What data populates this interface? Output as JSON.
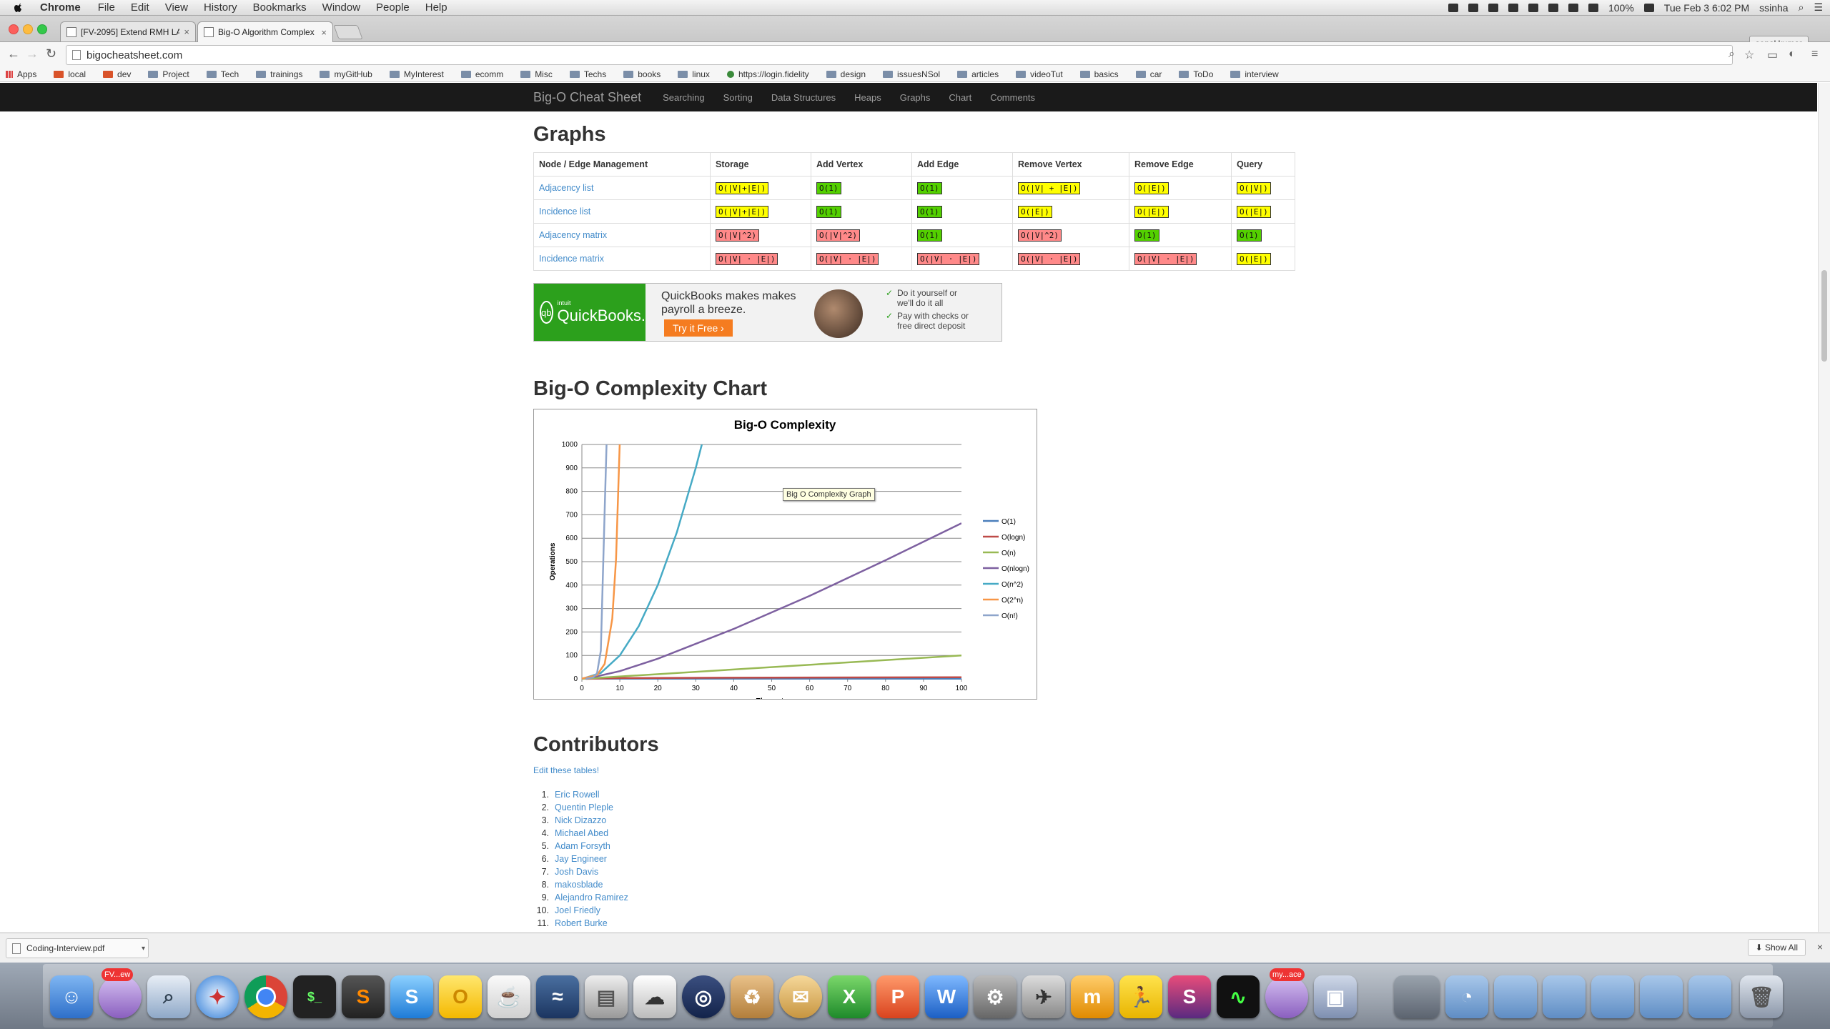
{
  "menubar": {
    "app": "Chrome",
    "items": [
      "File",
      "Edit",
      "View",
      "History",
      "Bookmarks",
      "Window",
      "People",
      "Help"
    ],
    "battery": "100%",
    "clock": "Tue Feb 3  6:02 PM",
    "user": "ssinha"
  },
  "tabs": [
    {
      "label": "[FV-2095] Extend RMH LA"
    },
    {
      "label": "Big-O Algorithm Complex"
    }
  ],
  "profile_button": "sonal kumar",
  "address": "bigocheatsheet.com",
  "bookmarks": [
    "Apps",
    "local",
    "dev",
    "Project",
    "Tech",
    "trainings",
    "myGitHub",
    "MyInterest",
    "ecomm",
    "Misc",
    "Techs",
    "books",
    "linux",
    "https://login.fidelity",
    "design",
    "issuesNSol",
    "articles",
    "videoTut",
    "basics",
    "car",
    "ToDo",
    "interview"
  ],
  "sitenav": {
    "brand": "Big-O Cheat Sheet",
    "links": [
      "Searching",
      "Sorting",
      "Data Structures",
      "Heaps",
      "Graphs",
      "Chart",
      "Comments"
    ]
  },
  "graphs": {
    "title": "Graphs",
    "headers": [
      "Node / Edge Management",
      "Storage",
      "Add Vertex",
      "Add Edge",
      "Remove Vertex",
      "Remove Edge",
      "Query"
    ],
    "rows": [
      {
        "name": "Adjacency list",
        "cells": [
          {
            "text": "O(|V|+|E|)",
            "color": "yellow"
          },
          {
            "text": "O(1)",
            "color": "green"
          },
          {
            "text": "O(1)",
            "color": "green"
          },
          {
            "text": "O(|V| + |E|)",
            "color": "yellow"
          },
          {
            "text": "O(|E|)",
            "color": "yellow"
          },
          {
            "text": "O(|V|)",
            "color": "yellow"
          }
        ]
      },
      {
        "name": "Incidence list",
        "cells": [
          {
            "text": "O(|V|+|E|)",
            "color": "yellow"
          },
          {
            "text": "O(1)",
            "color": "green"
          },
          {
            "text": "O(1)",
            "color": "green"
          },
          {
            "text": "O(|E|)",
            "color": "yellow"
          },
          {
            "text": "O(|E|)",
            "color": "yellow"
          },
          {
            "text": "O(|E|)",
            "color": "yellow"
          }
        ]
      },
      {
        "name": "Adjacency matrix",
        "cells": [
          {
            "text": "O(|V|^2)",
            "color": "red"
          },
          {
            "text": "O(|V|^2)",
            "color": "red"
          },
          {
            "text": "O(1)",
            "color": "green"
          },
          {
            "text": "O(|V|^2)",
            "color": "red"
          },
          {
            "text": "O(1)",
            "color": "green"
          },
          {
            "text": "O(1)",
            "color": "green"
          }
        ]
      },
      {
        "name": "Incidence matrix",
        "cells": [
          {
            "text": "O(|V| ⋅ |E|)",
            "color": "red"
          },
          {
            "text": "O(|V| ⋅ |E|)",
            "color": "red"
          },
          {
            "text": "O(|V| ⋅ |E|)",
            "color": "red"
          },
          {
            "text": "O(|V| ⋅ |E|)",
            "color": "red"
          },
          {
            "text": "O(|V| ⋅ |E|)",
            "color": "red"
          },
          {
            "text": "O(|E|)",
            "color": "yellow"
          }
        ]
      }
    ]
  },
  "ad": {
    "brand_small": "intuit",
    "brand": "QuickBooks.",
    "headline": "QuickBooks makes makes payroll a breeze.",
    "cta": "Try it Free",
    "bullets": [
      "Do it yourself or we'll do it all",
      "Pay with checks or free direct deposit"
    ]
  },
  "chart_section_title": "Big-O Complexity Chart",
  "tooltip": "Big O Complexity Graph",
  "chart_data": {
    "type": "line",
    "title": "Big-O Complexity",
    "xlabel": "Elements",
    "ylabel": "Operations",
    "xlim": [
      0,
      100
    ],
    "ylim": [
      0,
      1000
    ],
    "xticks": [
      0,
      10,
      20,
      30,
      40,
      50,
      60,
      70,
      80,
      90,
      100
    ],
    "yticks": [
      0,
      100,
      200,
      300,
      400,
      500,
      600,
      700,
      800,
      900,
      1000
    ],
    "grid": true,
    "legend": "right",
    "series": [
      {
        "name": "O(1)",
        "color": "#4a7ebb",
        "x": [
          1,
          100
        ],
        "y": [
          1,
          1
        ]
      },
      {
        "name": "O(logn)",
        "color": "#be4b48",
        "x": [
          1,
          10,
          50,
          100
        ],
        "y": [
          0,
          3.3,
          5.6,
          6.6
        ]
      },
      {
        "name": "O(n)",
        "color": "#98b954",
        "x": [
          0,
          100
        ],
        "y": [
          0,
          100
        ]
      },
      {
        "name": "O(nlogn)",
        "color": "#7d60a0",
        "x": [
          1,
          10,
          20,
          40,
          60,
          80,
          100
        ],
        "y": [
          0,
          33,
          86,
          213,
          354,
          506,
          664
        ]
      },
      {
        "name": "O(n^2)",
        "color": "#46aac5",
        "x": [
          0,
          5,
          10,
          15,
          20,
          25,
          30,
          31.6
        ],
        "y": [
          0,
          25,
          100,
          225,
          400,
          625,
          900,
          1000
        ]
      },
      {
        "name": "O(2^n)",
        "color": "#f79646",
        "x": [
          0,
          4,
          6,
          8,
          9,
          9.97
        ],
        "y": [
          1,
          16,
          64,
          256,
          512,
          1000
        ]
      },
      {
        "name": "O(n!)",
        "color": "#8ea5cb",
        "x": [
          1,
          3,
          4,
          5,
          6,
          6.5
        ],
        "y": [
          1,
          6,
          24,
          120,
          720,
          1000
        ]
      }
    ]
  },
  "contributors": {
    "title": "Contributors",
    "edit_link": "Edit these tables!",
    "names": [
      "Eric Rowell",
      "Quentin Pleple",
      "Nick Dizazzo",
      "Michael Abed",
      "Adam Forsyth",
      "Jay Engineer",
      "Josh Davis",
      "makosblade",
      "Alejandro Ramirez",
      "Joel Friedly",
      "Robert Burke"
    ]
  },
  "downloads": {
    "file": "Coding-Interview.pdf",
    "show_all": "Show All"
  },
  "dock": {
    "badges": [
      "FV...ew",
      "my...ace"
    ]
  }
}
